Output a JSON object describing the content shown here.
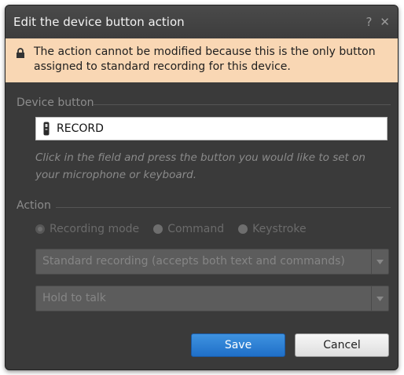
{
  "dialog": {
    "title": "Edit the device button action",
    "help_glyph": "?",
    "close_glyph": "✕",
    "notice_icon": "lock-icon",
    "notice_text": "The action cannot be modified because this is the only button assigned to standard recording for this device."
  },
  "device_button": {
    "section_label": "Device button",
    "value": "RECORD",
    "field_icon": "microphone-icon",
    "hint": "Click in the field and press the button you would like to set on your microphone or keyboard."
  },
  "action": {
    "section_label": "Action",
    "radio_options": [
      {
        "label": "Recording mode",
        "selected": true
      },
      {
        "label": "Command",
        "selected": false
      },
      {
        "label": "Keystroke",
        "selected": false
      }
    ],
    "recording_type": "Standard recording (accepts both text and commands)",
    "mode": "Hold to talk"
  },
  "buttons": {
    "save": "Save",
    "cancel": "Cancel"
  },
  "colors": {
    "dialog_bg": "#3a3a3a",
    "notice_bg": "#f9d7b4",
    "save_blue": "#2a7fd6"
  }
}
